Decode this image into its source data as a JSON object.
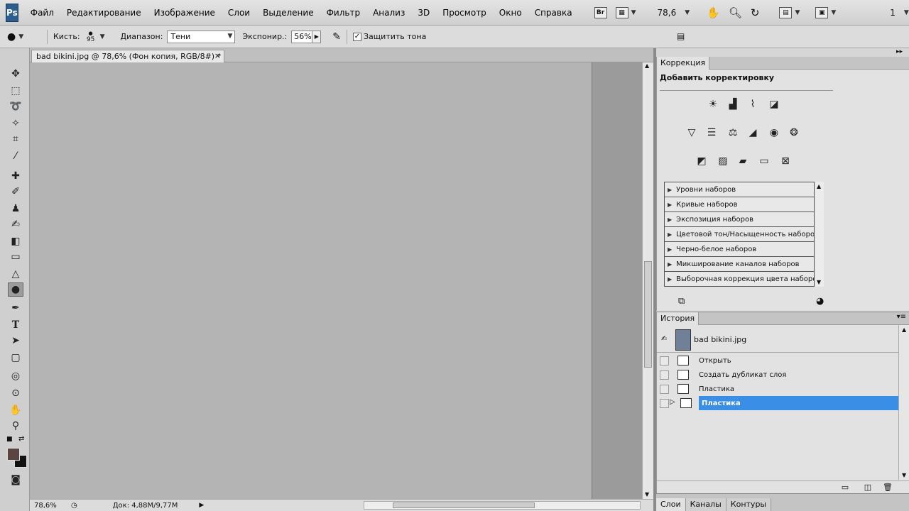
{
  "app": {
    "logo": "Ps"
  },
  "menu": {
    "items": [
      "Файл",
      "Редактирование",
      "Изображение",
      "Слои",
      "Выделение",
      "Фильтр",
      "Анализ",
      "3D",
      "Просмотр",
      "Окно",
      "Справка"
    ],
    "bridge_label": "Br",
    "zoom_value": "78,6",
    "workspace_number": "1"
  },
  "options": {
    "brush_label": "Кисть:",
    "brush_size": "95",
    "range_label": "Диапазон:",
    "range_value": "Тени",
    "exposure_label": "Экспонир.:",
    "exposure_value": "56%",
    "protect_label": "Защитить тона",
    "protect_checked": "✓"
  },
  "document": {
    "tab_title": "bad bikini.jpg @ 78,6% (Фон копия, RGB/8#) *",
    "close": "×"
  },
  "status": {
    "zoom": "78,6%",
    "doc_info": "Док: 4,88M/9,77M"
  },
  "adjustments": {
    "tab": "Коррекция",
    "heading": "Добавить корректировку",
    "presets": [
      "Уровни наборов",
      "Кривые наборов",
      "Экспозиция наборов",
      "Цветовой тон/Насыщенность наборов",
      "Черно-белое наборов",
      "Микширование каналов наборов",
      "Выборочная коррекция цвета наборов"
    ]
  },
  "history": {
    "tab": "История",
    "snapshot": "bad bikini.jpg",
    "steps": [
      "Открыть",
      "Создать дубликат слоя",
      "Пластика",
      "Пластика"
    ],
    "selected_index": 3
  },
  "layers": {
    "tabs": [
      "Слои",
      "Каналы",
      "Контуры"
    ]
  },
  "colors": {
    "foreground": "#5a4444",
    "background": "#111111",
    "selection": "#3a8ee6"
  }
}
